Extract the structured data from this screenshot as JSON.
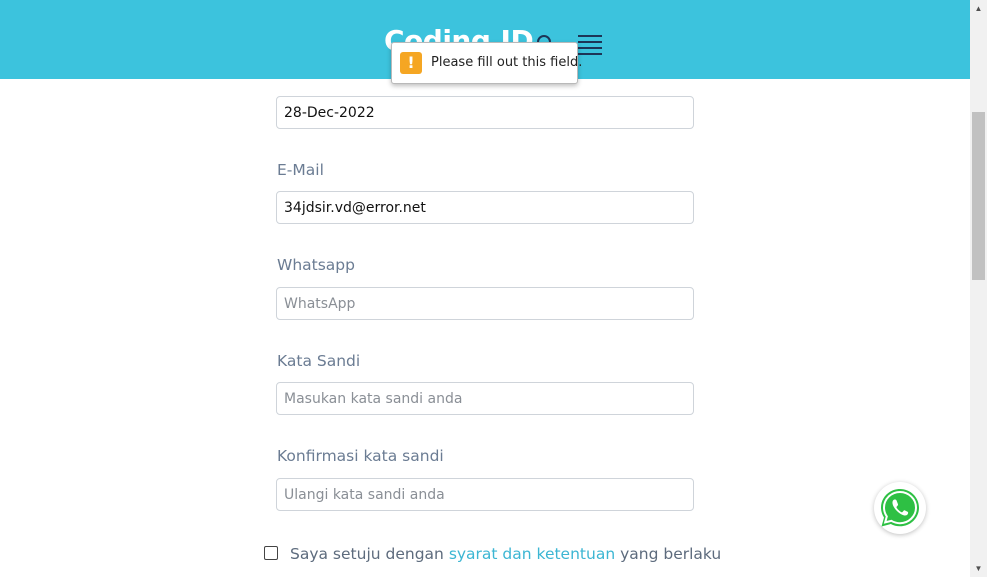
{
  "header": {
    "logo_text": "Coding.ID",
    "search_icon": "search-icon",
    "menu_icon": "hamburger-menu-icon",
    "background_color": "#3cc3dd"
  },
  "tooltip": {
    "icon": "warning-icon",
    "icon_glyph": "!",
    "message": "Please fill out this field."
  },
  "form": {
    "date_field": {
      "value": "28-Dec-2022"
    },
    "email": {
      "label": "E-Mail",
      "value": "34jdsir.vd@error.net"
    },
    "whatsapp": {
      "label": "Whatsapp",
      "placeholder": "WhatsApp"
    },
    "password": {
      "label": "Kata Sandi",
      "placeholder": "Masukan kata sandi anda"
    },
    "confirm_password": {
      "label": "Konfirmasi kata sandi",
      "placeholder": "Ulangi kata sandi anda"
    },
    "agreement": {
      "prefix": "Saya setuju dengan",
      "link": "syarat dan ketentuan",
      "suffix": "yang berlaku"
    }
  },
  "floating": {
    "whatsapp_icon": "whatsapp-icon"
  },
  "colors": {
    "accent": "#3cc3dd",
    "link": "#3cb6d3",
    "label": "#6b7c93"
  }
}
